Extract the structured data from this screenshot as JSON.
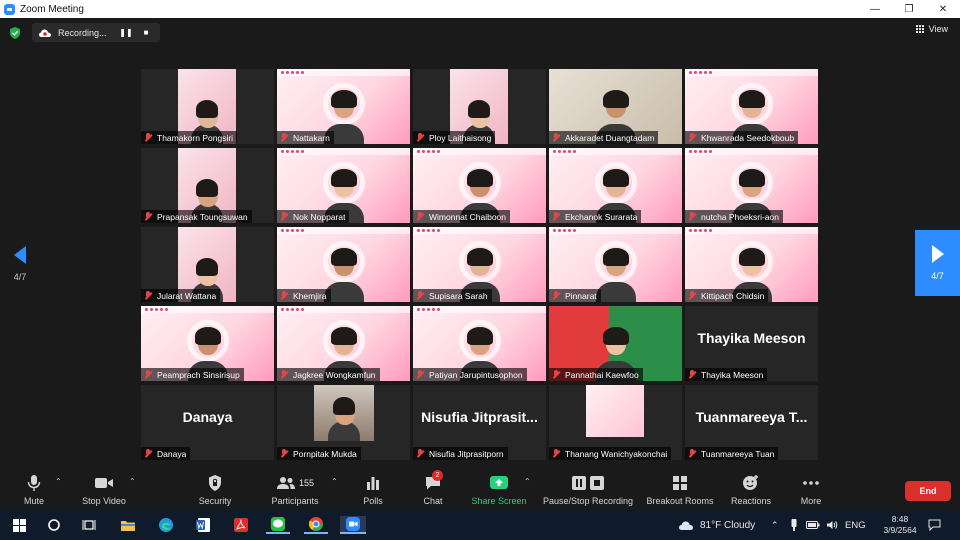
{
  "window": {
    "title": "Zoom Meeting"
  },
  "topbar": {
    "recording_label": "Recording...",
    "view_label": "View"
  },
  "pagination": {
    "prev_label": "4/7",
    "next_label": "4/7"
  },
  "participants": [
    {
      "name": "Thamakorn Pongsiri",
      "bg": "dark",
      "video": true,
      "small": true
    },
    {
      "name": "Nattakarn",
      "bg": "pink",
      "video": true
    },
    {
      "name": "Ploy Laithaisong",
      "bg": "dark",
      "video": true,
      "small": true
    },
    {
      "name": "Akkaradet Duangtadam",
      "bg": "room",
      "video": true
    },
    {
      "name": "Khwanrada Seedokboub",
      "bg": "pink",
      "video": true
    },
    {
      "name": "Prapansak Toungsuwan",
      "bg": "dark",
      "video": true,
      "small": true
    },
    {
      "name": "Nok Nopparat",
      "bg": "pink",
      "video": true
    },
    {
      "name": "Wimonnat Chaiboon",
      "bg": "pink",
      "video": true
    },
    {
      "name": "Ekchanok Surarata",
      "bg": "pink",
      "video": true
    },
    {
      "name": "nutcha Phoeksri-aon",
      "bg": "pink",
      "video": true
    },
    {
      "name": "Jularat Wattana",
      "bg": "dark",
      "video": true,
      "small": true
    },
    {
      "name": "Khemjira",
      "bg": "pink",
      "video": true
    },
    {
      "name": "Supisara Sarah",
      "bg": "pink",
      "video": true
    },
    {
      "name": "Pinnarat",
      "bg": "pink",
      "video": true
    },
    {
      "name": "Kittipach Chidsin",
      "bg": "pink",
      "video": true
    },
    {
      "name": "Peamprach Sinsirisup",
      "bg": "pink",
      "video": true
    },
    {
      "name": "Jagkree Wongkamfun",
      "bg": "pink",
      "video": true
    },
    {
      "name": "Patiyan Jarupintusophon",
      "bg": "pink",
      "video": true
    },
    {
      "name": "Pannathai Kaewfoo",
      "bg": "green",
      "video": true
    },
    {
      "name": "Thayika Meeson",
      "bg": "dark",
      "video": false,
      "display": "Thayika Meeson"
    },
    {
      "name": "Danaya",
      "bg": "dark",
      "video": false,
      "display": "Danaya"
    },
    {
      "name": "Pornpitak Mukda",
      "bg": "dark",
      "video": true,
      "photo": true
    },
    {
      "name": "Nisufia Jitprasitporn",
      "bg": "dark",
      "video": false,
      "display": "Nisufia  Jitprasit..."
    },
    {
      "name": "Thanang Wanichyakonchai",
      "bg": "dark",
      "video": true,
      "small": true,
      "slide": true
    },
    {
      "name": "Tuanmareeya Tuan",
      "bg": "dark",
      "video": false,
      "display": "Tuanmareeya  T..."
    }
  ],
  "toolbar": {
    "mute": "Mute",
    "stop_video": "Stop Video",
    "security": "Security",
    "participants": "Participants",
    "participants_count": "155",
    "polls": "Polls",
    "chat": "Chat",
    "chat_badge": "2",
    "share_screen": "Share Screen",
    "pause_stop_recording": "Pause/Stop Recording",
    "breakout_rooms": "Breakout Rooms",
    "reactions": "Reactions",
    "more": "More",
    "end": "End"
  },
  "taskbar": {
    "weather": "81°F  Cloudy",
    "language": "ENG",
    "time": "8:48",
    "date": "3/9/2564"
  },
  "colors": {
    "accent": "#2d8cff",
    "end": "#d9302c",
    "share": "#26d07c",
    "muted": "#e64545"
  }
}
